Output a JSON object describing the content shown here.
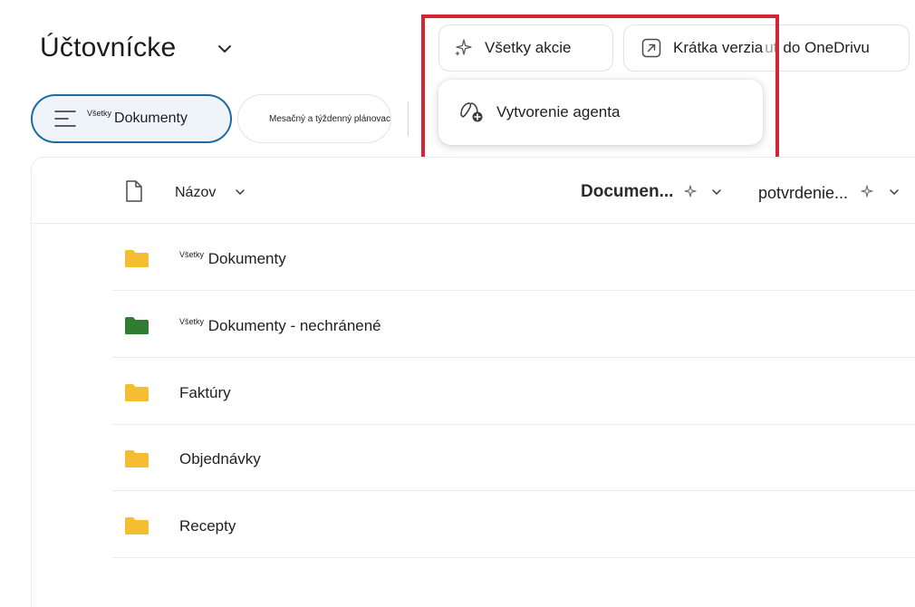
{
  "page": {
    "title": "Účtovnícke"
  },
  "header_actions": {
    "all_actions": "Všetky akcie",
    "short_version": "Krátka verzia",
    "short_version_ghost": "ut",
    "short_version_suffix": "do OneDrivu"
  },
  "dropdown": {
    "create_agent": "Vytvorenie agenta"
  },
  "view_pills": [
    {
      "sup": "Všetky",
      "label": "Dokumenty"
    },
    {
      "label": "Mesačný a týždenný plánovací kalendár (Word)"
    }
  ],
  "table": {
    "columns": {
      "name": "Názov",
      "documents": "Documen...",
      "confirmation": "potvrdenie..."
    },
    "rows": [
      {
        "sup": "Všetky",
        "name": "Dokumenty",
        "folder_color": "#f5bd32"
      },
      {
        "sup": "Všetky",
        "name": "Dokumenty - nechránené",
        "folder_color": "#2e7d32"
      },
      {
        "sup": "",
        "name": "Faktúry",
        "folder_color": "#f5bd32"
      },
      {
        "sup": "",
        "name": "Objednávky",
        "folder_color": "#f5bd32"
      },
      {
        "sup": "",
        "name": "Recepty",
        "folder_color": "#f5bd32"
      }
    ]
  },
  "icons": {
    "title_chevron": "chevron-down-icon",
    "all_actions": "sparkle-icon",
    "short_version": "open-external-icon",
    "create_agent": "agent-add-icon",
    "docs_pill": "list-lines-icon",
    "calendar_pill": "plus-icon",
    "file_header": "file-icon",
    "ai_column": "sparkle-icon"
  },
  "colors": {
    "accent_border": "#1f6aa5",
    "highlight_red": "#d32535",
    "folder_yellow": "#f5bd32",
    "folder_green": "#2e7d32"
  }
}
